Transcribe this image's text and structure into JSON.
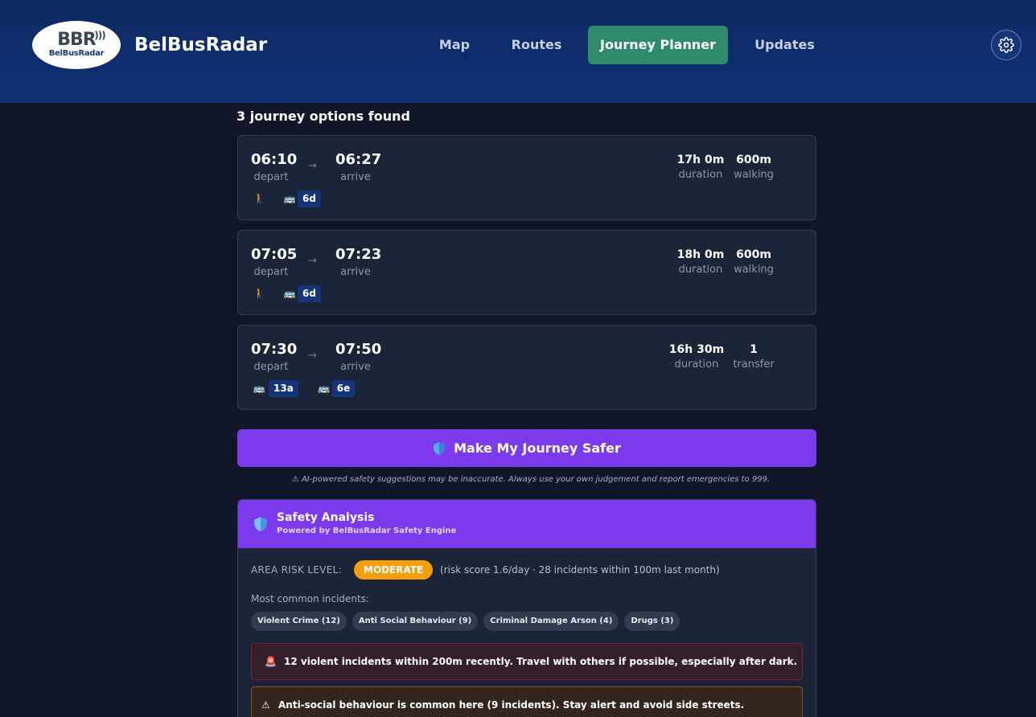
{
  "app": {
    "brand": "BelBusRadar",
    "logo_mark": "BBR",
    "logo_text": "BelBusRadar"
  },
  "nav": {
    "items": [
      {
        "label": "Map",
        "active": false
      },
      {
        "label": "Routes",
        "active": false
      },
      {
        "label": "Journey Planner",
        "active": true
      },
      {
        "label": "Updates",
        "active": false
      }
    ],
    "settings_icon": "gear-icon"
  },
  "results": {
    "title": "3 journey options found",
    "arrow": "→",
    "journeys": [
      {
        "depart": "06:10",
        "depart_label": "depart",
        "arrive": "06:27",
        "arrive_label": "arrive",
        "duration": "17h 0m",
        "duration_label": "duration",
        "extra": "600m",
        "extra_label": "walking",
        "legs": [
          {
            "type": "walk",
            "icon": "walking-icon",
            "glyph": "🚶"
          },
          {
            "type": "bus",
            "icon": "bus-icon",
            "glyph": "🚌",
            "route": "6d"
          }
        ]
      },
      {
        "depart": "07:05",
        "depart_label": "depart",
        "arrive": "07:23",
        "arrive_label": "arrive",
        "duration": "18h 0m",
        "duration_label": "duration",
        "extra": "600m",
        "extra_label": "walking",
        "legs": [
          {
            "type": "walk",
            "icon": "walking-icon",
            "glyph": "🚶"
          },
          {
            "type": "bus",
            "icon": "bus-icon",
            "glyph": "🚌",
            "route": "6d"
          }
        ]
      },
      {
        "depart": "07:30",
        "depart_label": "depart",
        "arrive": "07:50",
        "arrive_label": "arrive",
        "duration": "16h 30m",
        "duration_label": "duration",
        "extra": "1",
        "extra_label": "transfer",
        "legs": [
          {
            "type": "bus",
            "icon": "bus-icon",
            "glyph": "🚌",
            "route": "13a"
          },
          {
            "type": "bus",
            "icon": "bus-icon",
            "glyph": "🚌",
            "route": "6e"
          }
        ]
      }
    ]
  },
  "safer": {
    "button_label": "Make My Journey Safer",
    "button_icon": "shield-icon",
    "disclaimer": "⚠ AI-powered safety suggestions may be inaccurate. Always use your own judgement and report emergencies to 999."
  },
  "safety": {
    "title": "Safety Analysis",
    "subtitle": "Powered by BelBusRadar Safety Engine",
    "risk_label": "AREA RISK LEVEL:",
    "risk_level": "MODERATE",
    "risk_detail": "(risk score 1.6/day · 28 incidents within 100m last month)",
    "common_label": "Most common incidents:",
    "tags": [
      "Violent Crime (12)",
      "Anti Social Behaviour (9)",
      "Criminal Damage Arson (4)",
      "Drugs (3)"
    ],
    "alerts": [
      {
        "glyph": "🚨",
        "icon": "siren-icon",
        "text": "12 violent incidents within 200m recently. Travel with others if possible, especially after dark."
      },
      {
        "glyph": "⚠",
        "icon": "warning-icon",
        "text": "Anti-social behaviour is common here (9 incidents). Stay alert and avoid side streets."
      }
    ]
  },
  "colors": {
    "header_bg": "#0f2a63",
    "page_bg": "#111629",
    "active_nav": "#2f8a6c",
    "card_bg": "#1c2538",
    "route_badge": "#15357a",
    "accent_purple": "#7c3aed",
    "risk_moderate": "#f59e0b"
  }
}
